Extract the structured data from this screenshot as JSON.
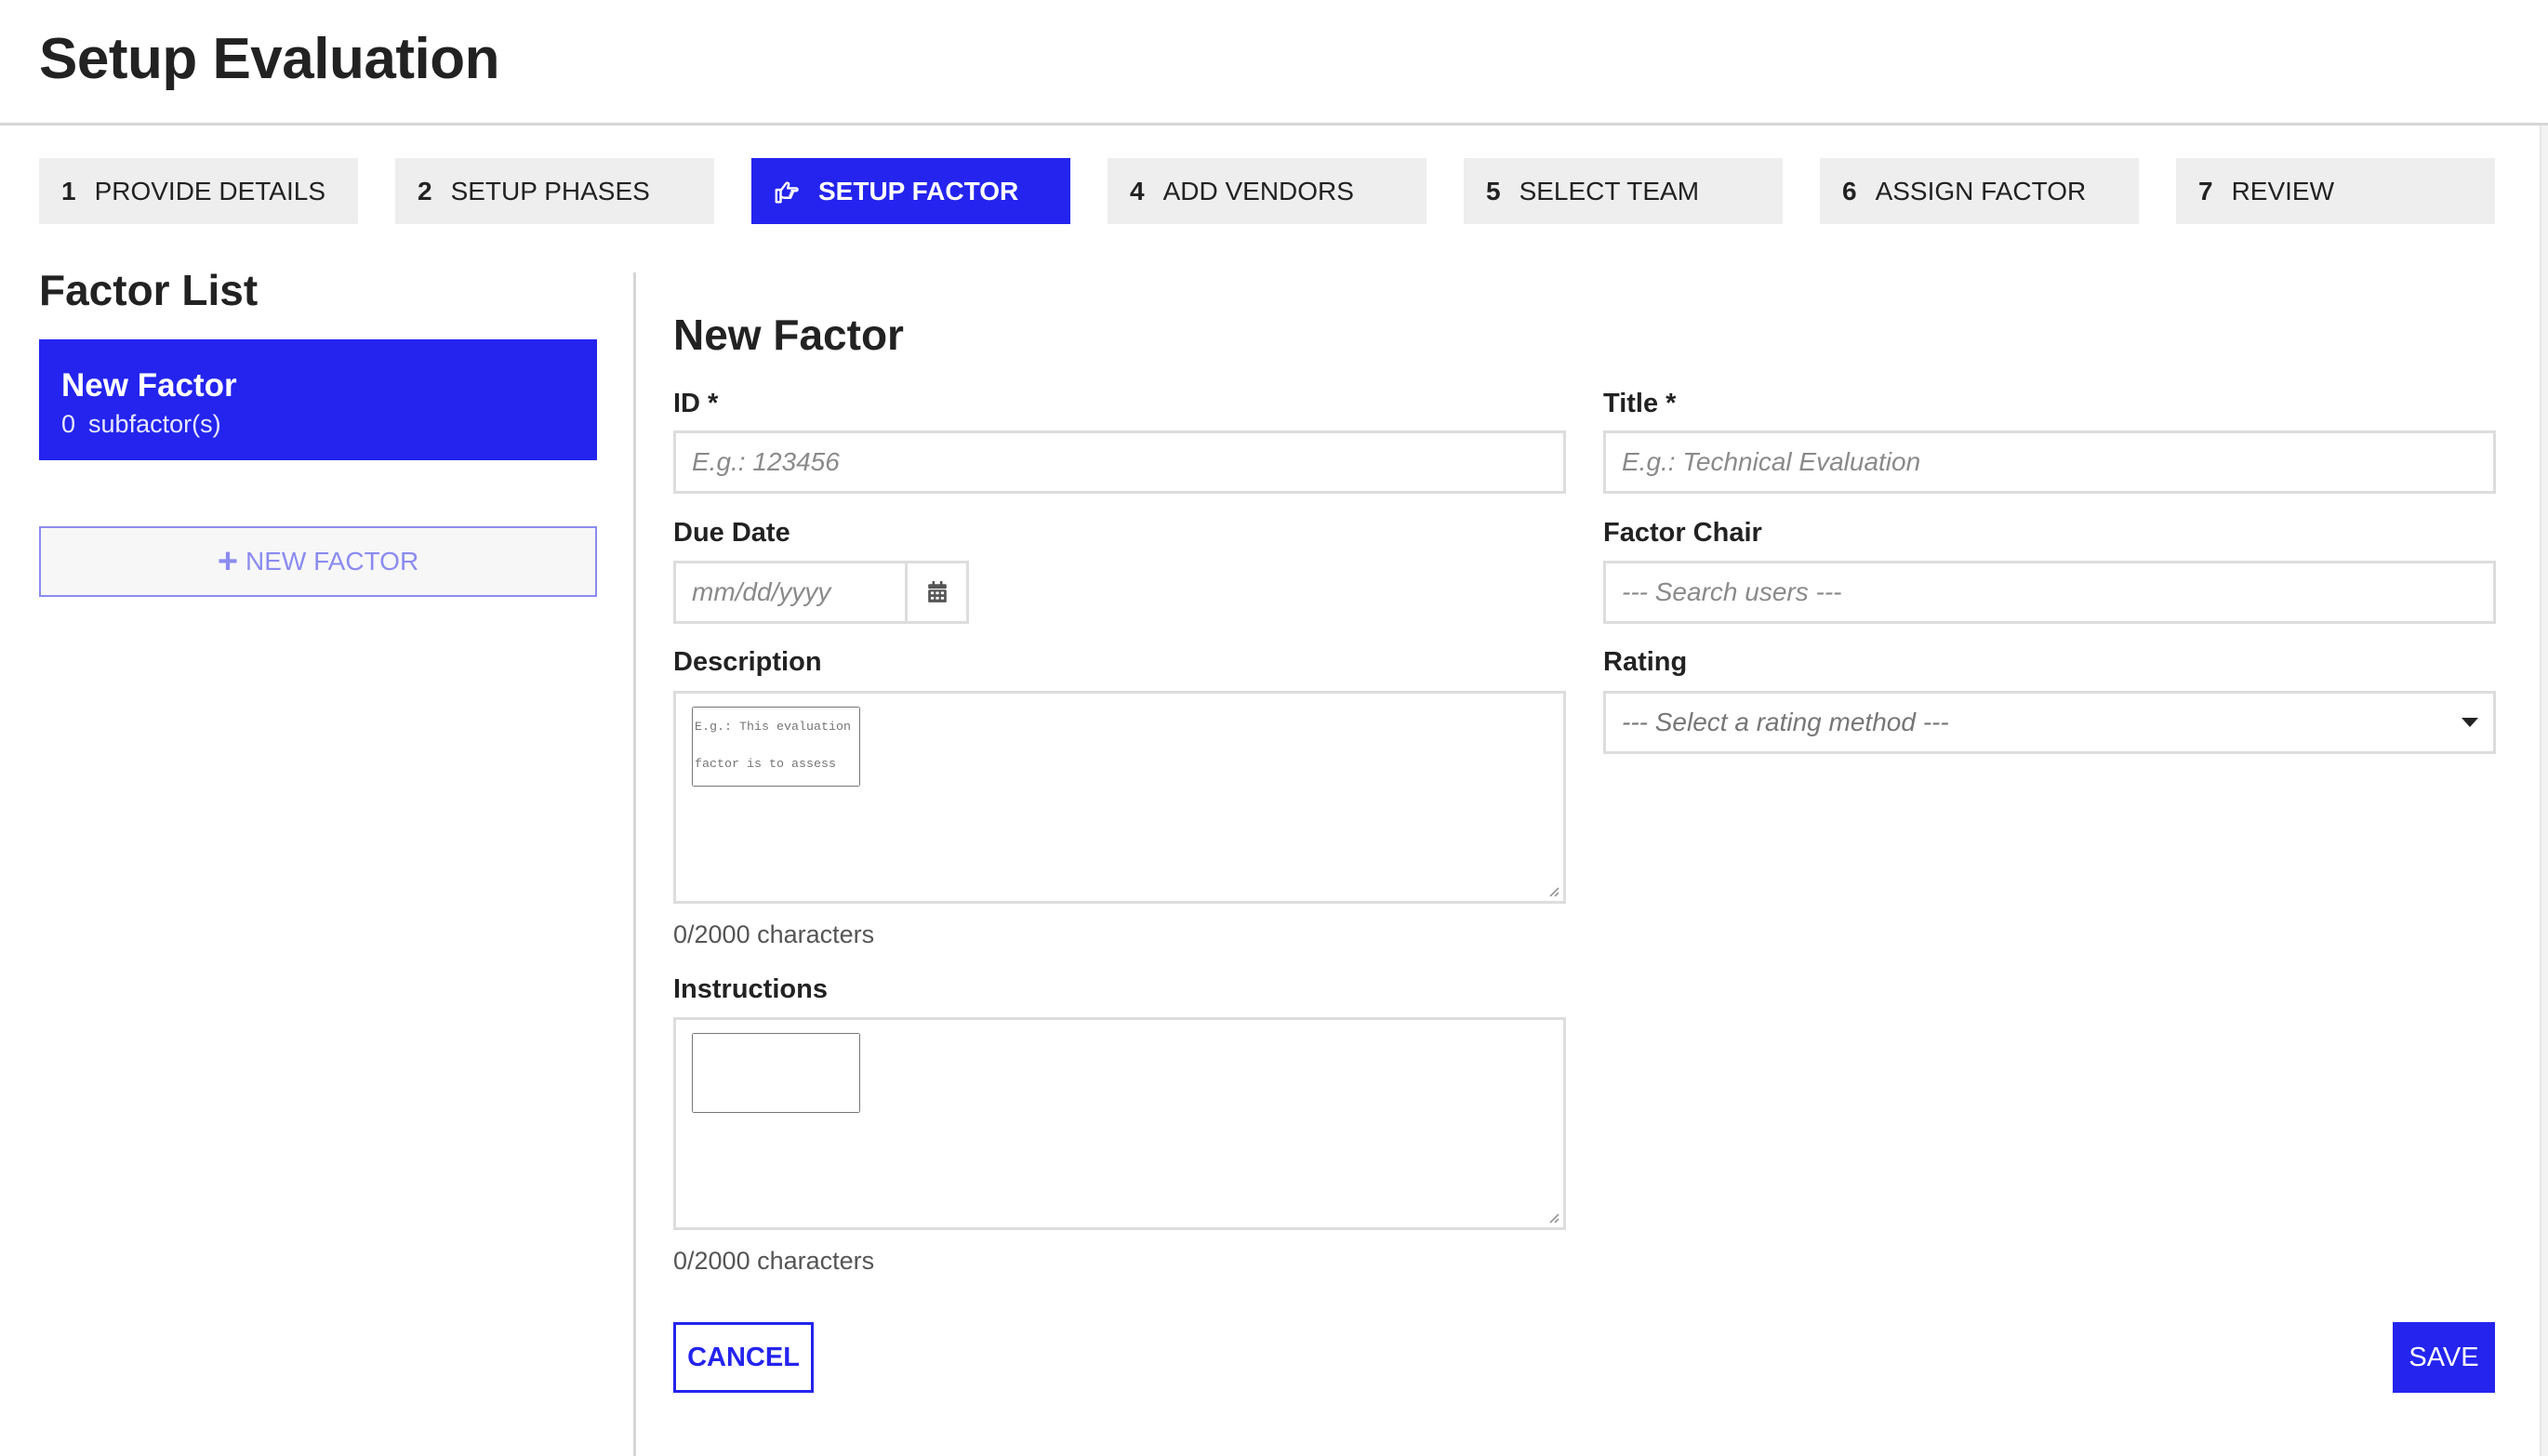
{
  "page": {
    "title": "Setup Evaluation"
  },
  "colors": {
    "accent": "#2424EE",
    "step_bg": "#EEEEEE",
    "border": "#DDDDDD",
    "muted_accent": "#8B8BF0"
  },
  "steps": [
    {
      "number": "1",
      "label": "PROVIDE DETAILS",
      "active": false
    },
    {
      "number": "2",
      "label": "SETUP PHASES",
      "active": false
    },
    {
      "number": "3",
      "label": "SETUP FACTOR",
      "active": true,
      "icon": "hand-point-right-icon"
    },
    {
      "number": "4",
      "label": "ADD VENDORS",
      "active": false
    },
    {
      "number": "5",
      "label": "SELECT TEAM",
      "active": false
    },
    {
      "number": "6",
      "label": "ASSIGN FACTOR",
      "active": false
    },
    {
      "number": "7",
      "label": "REVIEW",
      "active": false
    }
  ],
  "sidebar": {
    "title": "Factor List",
    "factors": [
      {
        "name": "New Factor",
        "subfactor_count": "0",
        "subfactor_label": "subfactor(s)",
        "selected": true
      }
    ],
    "new_factor_button": {
      "icon": "plus-icon",
      "label": "NEW FACTOR"
    }
  },
  "form": {
    "title": "New Factor",
    "id": {
      "label": "ID *",
      "value": "",
      "placeholder": "E.g.: 123456"
    },
    "title_field": {
      "label": "Title *",
      "value": "",
      "placeholder": "E.g.: Technical Evaluation"
    },
    "due_date": {
      "label": "Due Date",
      "value": "",
      "placeholder": "mm/dd/yyyy",
      "icon": "calendar-icon"
    },
    "factor_chair": {
      "label": "Factor Chair",
      "value": "",
      "placeholder": "--- Search users ---"
    },
    "description": {
      "label": "Description",
      "value": "",
      "placeholder": "E.g.: This evaluation factor is to assess the technical aspects of the proposal",
      "char_count": "0/2000 characters"
    },
    "rating": {
      "label": "Rating",
      "selected": "--- Select a rating method ---",
      "icon": "caret-down-icon"
    },
    "instructions": {
      "label": "Instructions",
      "value": "",
      "placeholder": "",
      "char_count": "0/2000 characters"
    },
    "cancel_label": "CANCEL",
    "save_label": "SAVE"
  }
}
